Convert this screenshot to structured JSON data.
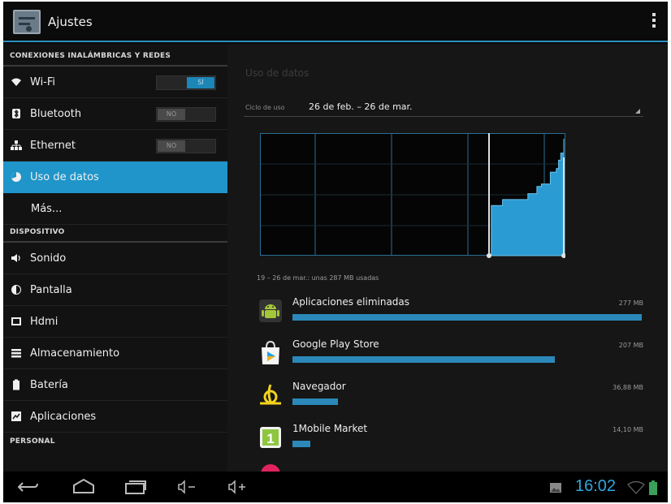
{
  "header": {
    "title": "Ajustes",
    "app_icon": "settings-sliders-icon",
    "overflow_icon": "overflow-menu-icon"
  },
  "sidebar": {
    "sections": [
      {
        "title": "CONEXIONES INALÁMBRICAS Y REDES",
        "items": [
          {
            "label": "Wi-Fi",
            "icon": "wifi-icon",
            "toggle": "SÍ",
            "toggle_state": "on"
          },
          {
            "label": "Bluetooth",
            "icon": "bluetooth-icon",
            "toggle": "NO",
            "toggle_state": "off"
          },
          {
            "label": "Ethernet",
            "icon": "ethernet-icon",
            "toggle": "NO",
            "toggle_state": "off"
          },
          {
            "label": "Uso de datos",
            "icon": "data-usage-icon",
            "active": true
          },
          {
            "label": "Más..."
          }
        ]
      },
      {
        "title": "DISPOSITIVO",
        "items": [
          {
            "label": "Sonido",
            "icon": "speaker-icon"
          },
          {
            "label": "Pantalla",
            "icon": "brightness-icon"
          },
          {
            "label": "Hdmi",
            "icon": "hdmi-icon"
          },
          {
            "label": "Almacenamiento",
            "icon": "storage-icon"
          },
          {
            "label": "Batería",
            "icon": "battery-icon"
          },
          {
            "label": "Aplicaciones",
            "icon": "apps-icon"
          }
        ]
      },
      {
        "title": "PERSONAL",
        "items": []
      }
    ]
  },
  "main": {
    "title": "Uso de datos",
    "cycle_label": "Ciclo de uso",
    "cycle_value": "26 de feb. – 26 de mar.",
    "usage_summary": "19 – 26 de mar.: unas 287 MB usadas",
    "apps": [
      {
        "name": "Aplicaciones eliminadas",
        "size": "277 MB",
        "usage_fraction": 1.0,
        "icon": "android-icon"
      },
      {
        "name": "Google Play Store",
        "size": "207 MB",
        "usage_fraction": 0.75,
        "icon": "play-store-icon"
      },
      {
        "name": "Navegador",
        "size": "36,88 MB",
        "usage_fraction": 0.13,
        "icon": "browser-icon"
      },
      {
        "name": "1Mobile Market",
        "size": "14,10 MB",
        "usage_fraction": 0.05,
        "icon": "1mobile-market-icon"
      }
    ],
    "chart_data": {
      "type": "area",
      "x_range": [
        "26 de feb.",
        "26 de mar."
      ],
      "highlight_range": [
        "19 de mar.",
        "26 de mar."
      ],
      "cumulative_fraction": [
        {
          "day": 0.0,
          "v": 0.0
        },
        {
          "day": 0.03,
          "v": 0.42
        },
        {
          "day": 0.18,
          "v": 0.47
        },
        {
          "day": 0.48,
          "v": 0.47
        },
        {
          "day": 0.52,
          "v": 0.52
        },
        {
          "day": 0.6,
          "v": 0.52
        },
        {
          "day": 0.64,
          "v": 0.58
        },
        {
          "day": 0.7,
          "v": 0.6
        },
        {
          "day": 0.78,
          "v": 0.6
        },
        {
          "day": 0.82,
          "v": 0.7
        },
        {
          "day": 0.9,
          "v": 0.73
        },
        {
          "day": 0.93,
          "v": 0.8
        },
        {
          "day": 0.96,
          "v": 0.86
        },
        {
          "day": 1.0,
          "v": 0.98
        }
      ],
      "grid": true
    }
  },
  "navbar": {
    "back_icon": "back-icon",
    "home_icon": "home-icon",
    "recents_icon": "recent-apps-icon",
    "vol_down_icon": "volume-down-icon",
    "vol_up_icon": "volume-up-icon",
    "gallery_icon": "gallery-icon",
    "clock": "16:02",
    "wifi_icon": "wifi-status-icon",
    "battery_icon": "battery-status-icon"
  },
  "colors": {
    "accent": "#1f95c9",
    "chart_fill": "#2b9bd3",
    "background": "#161616"
  }
}
